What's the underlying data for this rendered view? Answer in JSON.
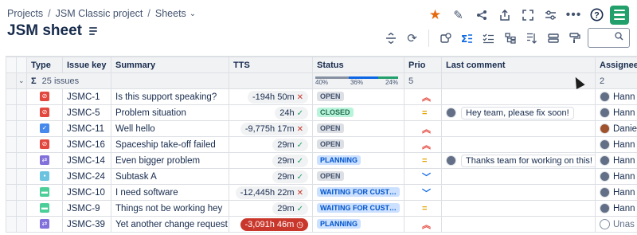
{
  "breadcrumb": {
    "items": [
      "Projects",
      "JSM Classic project",
      "Sheets"
    ]
  },
  "page_title": "JSM sheet",
  "search": {
    "placeholder": ""
  },
  "columns": [
    "Type",
    "Issue key",
    "Summary",
    "TTS",
    "Status",
    "Prio",
    "Last comment",
    "Assignee"
  ],
  "summary_row": {
    "issues_label": "25 issues",
    "sigma": "Σ",
    "status_pcts": [
      "40%",
      "36%",
      "24%"
    ],
    "status_fractions": [
      0.4,
      0.36,
      0.24
    ],
    "status_colors": [
      "#8590a2",
      "#0c66e4",
      "#22a06b"
    ],
    "prio_count": "5",
    "assignee_count": "2"
  },
  "rows": [
    {
      "type": "incident",
      "type_color": "#e2483d",
      "key": "JSMC-1",
      "summary": "Is this support speaking?",
      "tts": "-194h 50m",
      "tts_mark": "✕",
      "tts_state": "overdue",
      "status": "OPEN",
      "status_style": "gray",
      "prio": "high",
      "comment": "",
      "assignee": "Hann",
      "assignee_avatar": "user"
    },
    {
      "type": "incident",
      "type_color": "#e2483d",
      "key": "JSMC-5",
      "summary": "Problem situation",
      "tts": "24h",
      "tts_mark": "✓",
      "tts_state": "ok",
      "status": "CLOSED",
      "status_style": "green",
      "prio": "medium",
      "comment": "Hey team, please fix soon!",
      "assignee": "Hann",
      "assignee_avatar": "user"
    },
    {
      "type": "task",
      "type_color": "#4688ec",
      "key": "JSMC-11",
      "summary": "Well hello",
      "tts": "-9,775h 17m",
      "tts_mark": "✕",
      "tts_state": "overdue",
      "status": "OPEN",
      "status_style": "gray",
      "prio": "high",
      "comment": "",
      "assignee": "Danie",
      "assignee_avatar": "user-alt"
    },
    {
      "type": "incident",
      "type_color": "#e2483d",
      "key": "JSMC-16",
      "summary": "Spaceship take-off failed",
      "tts": "29m",
      "tts_mark": "✓",
      "tts_state": "ok",
      "status": "OPEN",
      "status_style": "gray",
      "prio": "high",
      "comment": "",
      "assignee": "Hann",
      "assignee_avatar": "user"
    },
    {
      "type": "change",
      "type_color": "#8270db",
      "key": "JSMC-14",
      "summary": "Even bigger problem",
      "tts": "29m",
      "tts_mark": "✓",
      "tts_state": "ok",
      "status": "PLANNING",
      "status_style": "blue",
      "prio": "medium",
      "comment": "Thanks team for working on this!",
      "assignee": "Hann",
      "assignee_avatar": "user"
    },
    {
      "type": "subtask",
      "type_color": "#6cc3e0",
      "key": "JSMC-24",
      "summary": "Subtask A",
      "tts": "29m",
      "tts_mark": "✓",
      "tts_state": "ok",
      "status": "OPEN",
      "status_style": "gray",
      "prio": "low",
      "comment": "",
      "assignee": "Hann",
      "assignee_avatar": "user"
    },
    {
      "type": "request",
      "type_color": "#4bce97",
      "key": "JSMC-10",
      "summary": "I need software",
      "tts": "-12,445h 22m",
      "tts_mark": "✕",
      "tts_state": "overdue",
      "status": "WAITING FOR CUSTO...",
      "status_style": "blue",
      "prio": "low",
      "comment": "",
      "assignee": "Hann",
      "assignee_avatar": "user"
    },
    {
      "type": "request",
      "type_color": "#4bce97",
      "key": "JSMC-9",
      "summary": "Things not be working hey",
      "tts": "29m",
      "tts_mark": "✓",
      "tts_state": "ok",
      "status": "WAITING FOR CUSTO...",
      "status_style": "blue",
      "prio": "medium",
      "comment": "",
      "assignee": "Hann",
      "assignee_avatar": "user"
    },
    {
      "type": "change",
      "type_color": "#8270db",
      "key": "JSMC-39",
      "summary": "Yet another change request",
      "tts": "-3,091h 46m",
      "tts_mark": "◷",
      "tts_state": "breached",
      "status": "PLANNING",
      "status_style": "blue",
      "prio": "high",
      "comment": "",
      "assignee": "Unas",
      "assignee_avatar": "none"
    }
  ],
  "icons": {
    "top": [
      "star-icon",
      "edit-icon",
      "share-icon",
      "export-icon",
      "fullscreen-icon",
      "settings-sliders-icon",
      "more-icon",
      "help-icon",
      "app-logo-icon"
    ],
    "toolbar": [
      "row-height-icon",
      "refresh-icon",
      "search-record-icon",
      "sigma-summary-icon",
      "checklist-icon",
      "hierarchy-icon",
      "filter-icon",
      "group-icon",
      "paint-format-icon"
    ],
    "star_color": "#e56910"
  }
}
